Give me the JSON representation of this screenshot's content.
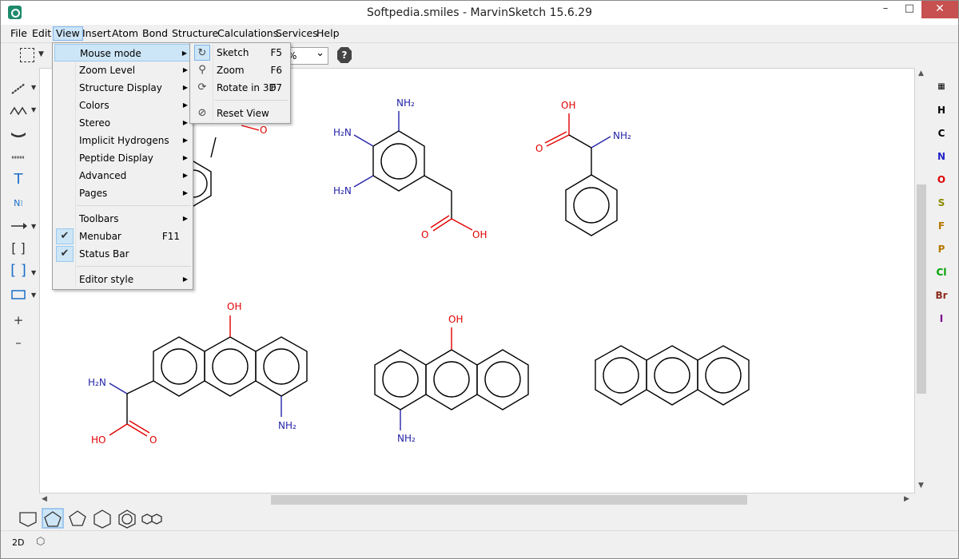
{
  "window": {
    "title": "Softpedia.smiles - MarvinSketch 15.6.29",
    "min_glyph": "–",
    "max_glyph": "□",
    "close_glyph": "✕"
  },
  "menubar": {
    "items": [
      "File",
      "Edit",
      "View",
      "Insert",
      "Atom",
      "Bond",
      "Structure",
      "Calculations",
      "Services",
      "Help"
    ]
  },
  "toolbar": {
    "zoom_value": "%",
    "help_glyph": "?"
  },
  "view_menu": {
    "items": [
      {
        "label": "Mouse mode",
        "submenu": true
      },
      {
        "label": "Zoom Level",
        "submenu": true
      },
      {
        "label": "Structure Display",
        "submenu": true
      },
      {
        "label": "Colors",
        "submenu": true
      },
      {
        "label": "Stereo",
        "submenu": true
      },
      {
        "label": "Implicit Hydrogens",
        "submenu": true
      },
      {
        "label": "Peptide Display",
        "submenu": true
      },
      {
        "label": "Advanced",
        "submenu": true
      },
      {
        "label": "Pages",
        "submenu": true
      },
      {
        "label": "Toolbars",
        "submenu": true
      },
      {
        "label": "Menubar",
        "shortcut": "F11",
        "checked": true
      },
      {
        "label": "Status Bar",
        "checked": true
      },
      {
        "label": "Editor style",
        "submenu": true
      }
    ]
  },
  "mouse_mode_menu": {
    "items": [
      {
        "label": "Sketch",
        "shortcut": "F5",
        "icon": "sketch-icon",
        "active": true
      },
      {
        "label": "Zoom",
        "shortcut": "F6",
        "icon": "zoom-icon"
      },
      {
        "label": "Rotate in 3D",
        "shortcut": "F7",
        "icon": "rotate-3d-icon"
      },
      {
        "label": "Reset View",
        "icon": "reset-view-icon"
      }
    ]
  },
  "left_tools": {
    "text_tool": "T",
    "plus": "+",
    "minus": "–"
  },
  "periodic": {
    "elements": [
      {
        "symbol": "H",
        "color": "#000000"
      },
      {
        "symbol": "C",
        "color": "#000000"
      },
      {
        "symbol": "N",
        "color": "#2424c8"
      },
      {
        "symbol": "O",
        "color": "#e00000"
      },
      {
        "symbol": "S",
        "color": "#8a8a00"
      },
      {
        "symbol": "F",
        "color": "#b87800"
      },
      {
        "symbol": "P",
        "color": "#b87800"
      },
      {
        "symbol": "Cl",
        "color": "#00a000"
      },
      {
        "symbol": "Br",
        "color": "#8b2a1e"
      },
      {
        "symbol": "I",
        "color": "#7a008a"
      }
    ]
  },
  "molecule_labels": {
    "nh2": "NH₂",
    "h2n": "H₂N",
    "oh": "OH",
    "ho": "HO",
    "o": "O"
  },
  "status": {
    "mode": "2D"
  },
  "colors": {
    "nitrogen": "#2424a8",
    "oxygen": "#e00000",
    "bond": "#000000",
    "menu_highlight": "#cde6f7"
  }
}
